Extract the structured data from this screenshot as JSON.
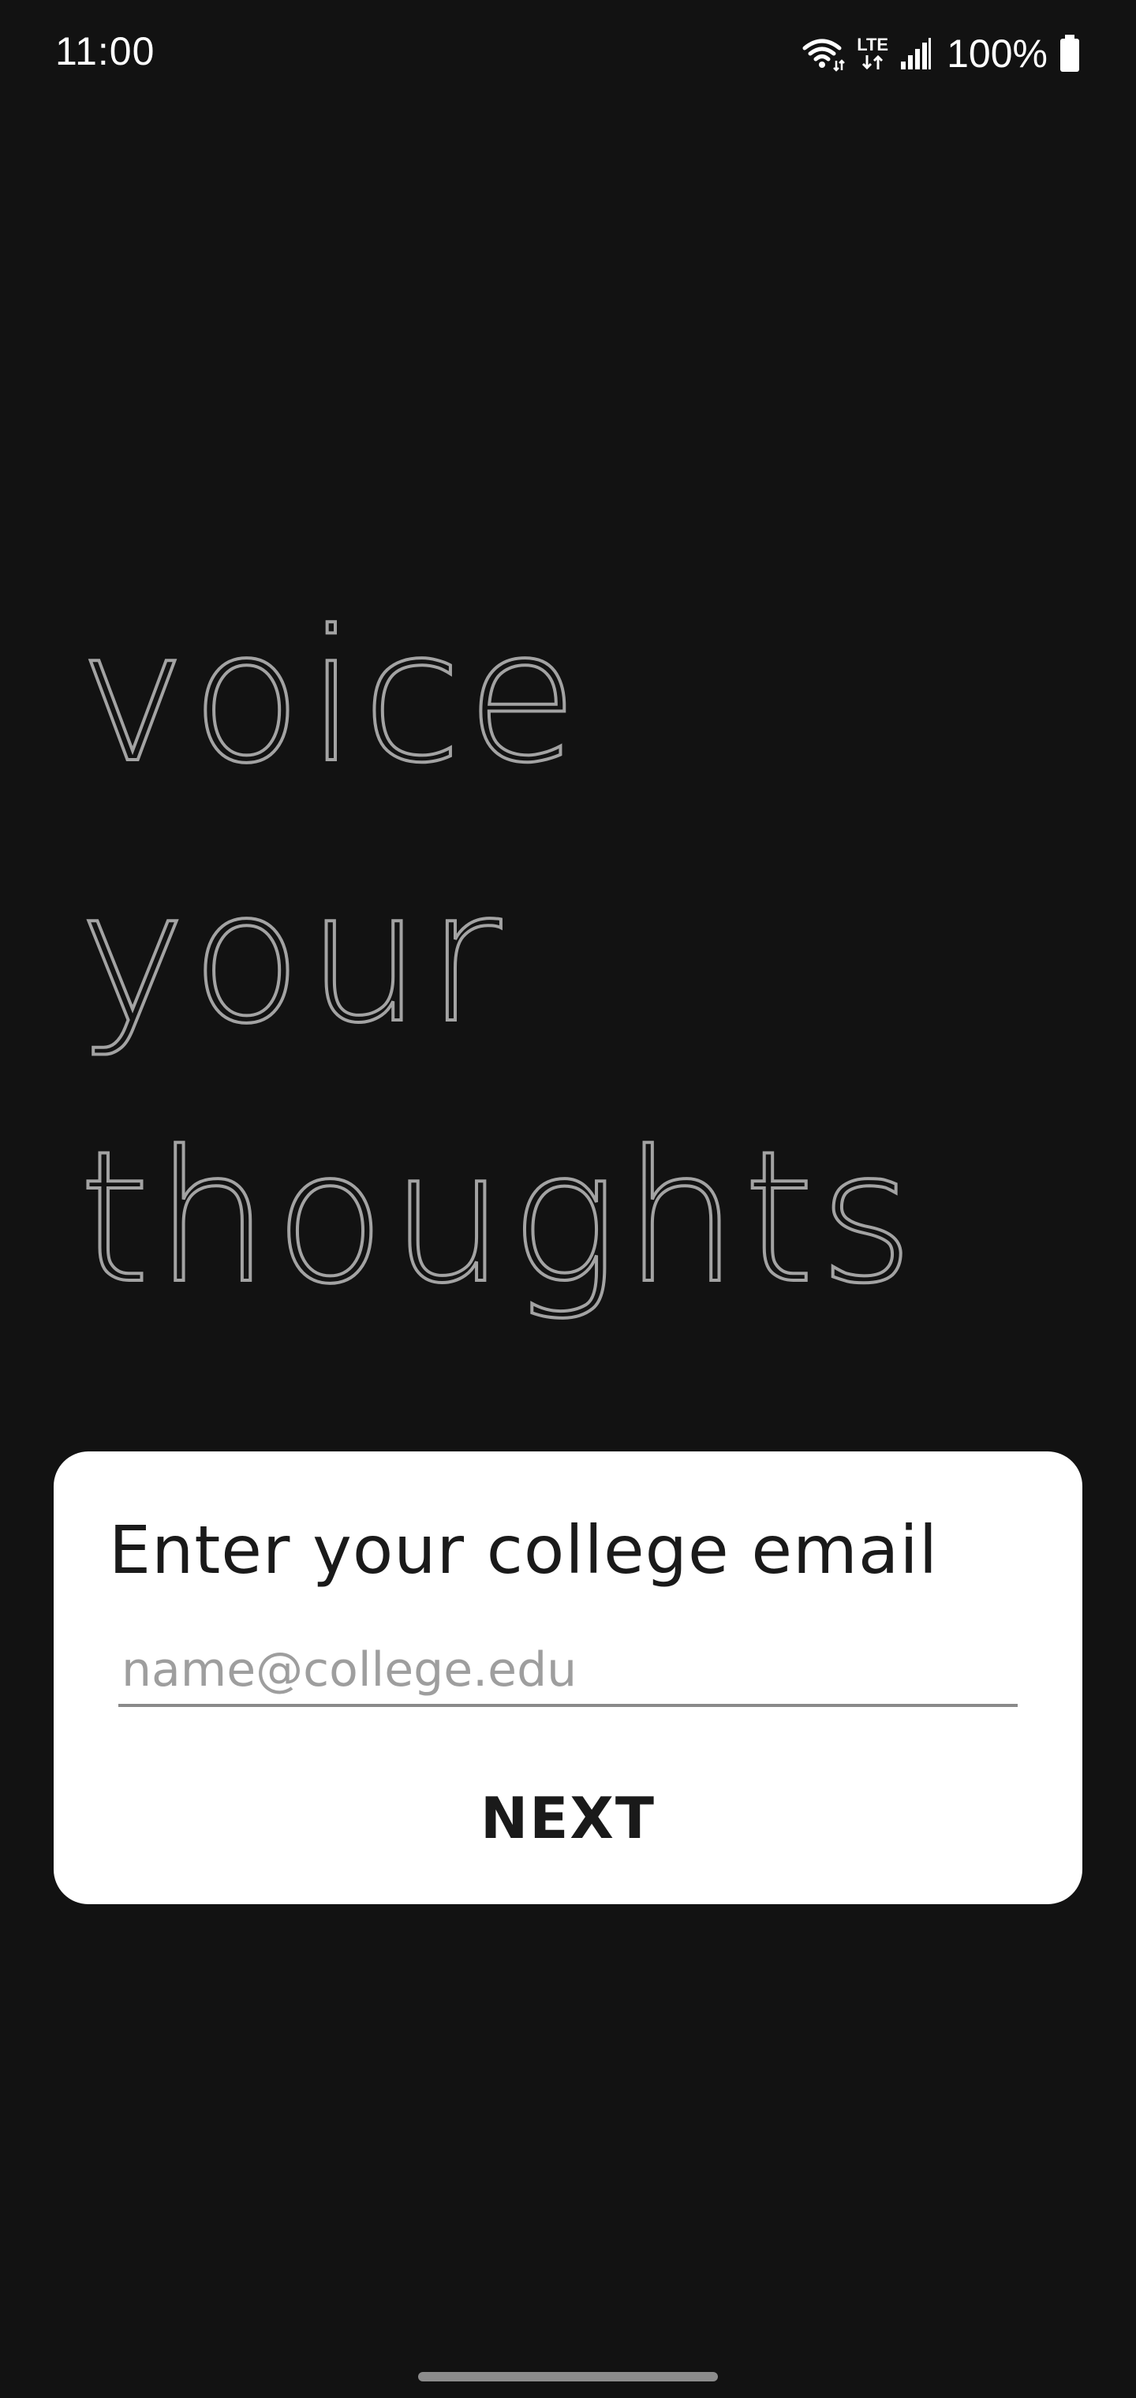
{
  "status_bar": {
    "time": "11:00",
    "network": "LTE",
    "battery": "100%",
    "icons": [
      "wifi-icon",
      "lte-icon",
      "signal-icon",
      "battery-icon"
    ]
  },
  "hero": {
    "lines": [
      "voice",
      "your",
      "thoughts"
    ]
  },
  "card": {
    "title": "Enter your college email",
    "email_placeholder": "name@college.edu",
    "email_value": "",
    "next_label": "NEXT"
  },
  "colors": {
    "background": "#121212",
    "card": "#ffffff",
    "hero_text": "#a3a3a3",
    "card_text": "#1a1a1a"
  }
}
